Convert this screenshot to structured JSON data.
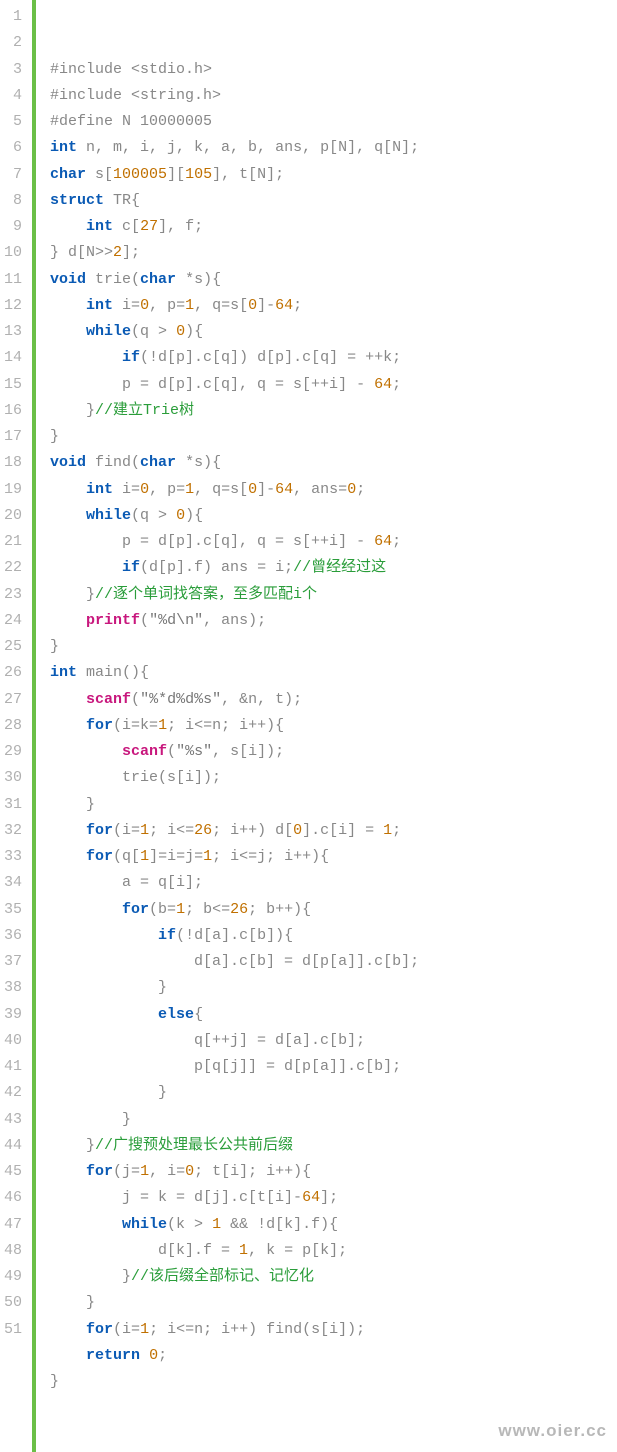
{
  "watermark": "www.oier.cc",
  "lines": [
    {
      "n": "1",
      "seg": [
        {
          "c": "pp",
          "t": "#include <stdio.h>"
        }
      ]
    },
    {
      "n": "2",
      "seg": [
        {
          "c": "pp",
          "t": "#include <string.h>"
        }
      ]
    },
    {
      "n": "3",
      "seg": [
        {
          "c": "pp",
          "t": "#define N 10000005"
        }
      ]
    },
    {
      "n": "4",
      "seg": [
        {
          "c": "type",
          "t": "int"
        },
        {
          "c": "plain",
          "t": " n, m, i, j, k, a, b, ans, p[N], q[N];"
        }
      ]
    },
    {
      "n": "5",
      "seg": [
        {
          "c": "type",
          "t": "char"
        },
        {
          "c": "plain",
          "t": " s["
        },
        {
          "c": "num",
          "t": "100005"
        },
        {
          "c": "plain",
          "t": "]["
        },
        {
          "c": "num",
          "t": "105"
        },
        {
          "c": "plain",
          "t": "], t[N];"
        }
      ]
    },
    {
      "n": "6",
      "seg": [
        {
          "c": "type",
          "t": "struct"
        },
        {
          "c": "plain",
          "t": " TR{"
        }
      ]
    },
    {
      "n": "7",
      "seg": [
        {
          "c": "plain",
          "t": "    "
        },
        {
          "c": "type",
          "t": "int"
        },
        {
          "c": "plain",
          "t": " c["
        },
        {
          "c": "num",
          "t": "27"
        },
        {
          "c": "plain",
          "t": "], f;"
        }
      ]
    },
    {
      "n": "8",
      "seg": [
        {
          "c": "plain",
          "t": "} d[N>>"
        },
        {
          "c": "num",
          "t": "2"
        },
        {
          "c": "plain",
          "t": "];"
        }
      ]
    },
    {
      "n": "9",
      "seg": [
        {
          "c": "type",
          "t": "void"
        },
        {
          "c": "plain",
          "t": " trie("
        },
        {
          "c": "type",
          "t": "char"
        },
        {
          "c": "plain",
          "t": " *s){"
        }
      ]
    },
    {
      "n": "10",
      "seg": [
        {
          "c": "plain",
          "t": "    "
        },
        {
          "c": "type",
          "t": "int"
        },
        {
          "c": "plain",
          "t": " i="
        },
        {
          "c": "num",
          "t": "0"
        },
        {
          "c": "plain",
          "t": ", p="
        },
        {
          "c": "num",
          "t": "1"
        },
        {
          "c": "plain",
          "t": ", q=s["
        },
        {
          "c": "num",
          "t": "0"
        },
        {
          "c": "plain",
          "t": "]-"
        },
        {
          "c": "num",
          "t": "64"
        },
        {
          "c": "plain",
          "t": ";"
        }
      ]
    },
    {
      "n": "11",
      "seg": [
        {
          "c": "plain",
          "t": "    "
        },
        {
          "c": "kw",
          "t": "while"
        },
        {
          "c": "plain",
          "t": "(q > "
        },
        {
          "c": "num",
          "t": "0"
        },
        {
          "c": "plain",
          "t": "){"
        }
      ]
    },
    {
      "n": "12",
      "seg": [
        {
          "c": "plain",
          "t": "        "
        },
        {
          "c": "kw",
          "t": "if"
        },
        {
          "c": "plain",
          "t": "(!d[p].c[q]) d[p].c[q] = ++k;"
        }
      ]
    },
    {
      "n": "13",
      "seg": [
        {
          "c": "plain",
          "t": "        p = d[p].c[q], q = s[++i] - "
        },
        {
          "c": "num",
          "t": "64"
        },
        {
          "c": "plain",
          "t": ";"
        }
      ]
    },
    {
      "n": "14",
      "seg": [
        {
          "c": "plain",
          "t": "    }"
        },
        {
          "c": "cmt",
          "t": "//建立Trie树"
        }
      ]
    },
    {
      "n": "15",
      "seg": [
        {
          "c": "plain",
          "t": "}"
        }
      ]
    },
    {
      "n": "16",
      "seg": [
        {
          "c": "type",
          "t": "void"
        },
        {
          "c": "plain",
          "t": " find("
        },
        {
          "c": "type",
          "t": "char"
        },
        {
          "c": "plain",
          "t": " *s){"
        }
      ]
    },
    {
      "n": "17",
      "seg": [
        {
          "c": "plain",
          "t": "    "
        },
        {
          "c": "type",
          "t": "int"
        },
        {
          "c": "plain",
          "t": " i="
        },
        {
          "c": "num",
          "t": "0"
        },
        {
          "c": "plain",
          "t": ", p="
        },
        {
          "c": "num",
          "t": "1"
        },
        {
          "c": "plain",
          "t": ", q=s["
        },
        {
          "c": "num",
          "t": "0"
        },
        {
          "c": "plain",
          "t": "]-"
        },
        {
          "c": "num",
          "t": "64"
        },
        {
          "c": "plain",
          "t": ", ans="
        },
        {
          "c": "num",
          "t": "0"
        },
        {
          "c": "plain",
          "t": ";"
        }
      ]
    },
    {
      "n": "18",
      "seg": [
        {
          "c": "plain",
          "t": "    "
        },
        {
          "c": "kw",
          "t": "while"
        },
        {
          "c": "plain",
          "t": "(q > "
        },
        {
          "c": "num",
          "t": "0"
        },
        {
          "c": "plain",
          "t": "){"
        }
      ]
    },
    {
      "n": "19",
      "seg": [
        {
          "c": "plain",
          "t": "        p = d[p].c[q], q = s[++i] - "
        },
        {
          "c": "num",
          "t": "64"
        },
        {
          "c": "plain",
          "t": ";"
        }
      ]
    },
    {
      "n": "20",
      "seg": [
        {
          "c": "plain",
          "t": "        "
        },
        {
          "c": "kw",
          "t": "if"
        },
        {
          "c": "plain",
          "t": "(d[p].f) ans = i;"
        },
        {
          "c": "cmt",
          "t": "//曾经经过这"
        }
      ]
    },
    {
      "n": "21",
      "seg": [
        {
          "c": "plain",
          "t": "    }"
        },
        {
          "c": "cmt",
          "t": "//逐个单词找答案，至多匹配i个"
        }
      ]
    },
    {
      "n": "22",
      "seg": [
        {
          "c": "plain",
          "t": "    "
        },
        {
          "c": "fn",
          "t": "printf"
        },
        {
          "c": "plain",
          "t": "("
        },
        {
          "c": "str",
          "t": "\"%d\\n\""
        },
        {
          "c": "plain",
          "t": ", ans);"
        }
      ]
    },
    {
      "n": "23",
      "seg": [
        {
          "c": "plain",
          "t": "}"
        }
      ]
    },
    {
      "n": "24",
      "seg": [
        {
          "c": "type",
          "t": "int"
        },
        {
          "c": "plain",
          "t": " main(){"
        }
      ]
    },
    {
      "n": "25",
      "seg": [
        {
          "c": "plain",
          "t": "    "
        },
        {
          "c": "fn",
          "t": "scanf"
        },
        {
          "c": "plain",
          "t": "("
        },
        {
          "c": "str",
          "t": "\"%*d%d%s\""
        },
        {
          "c": "plain",
          "t": ", &n, t);"
        }
      ]
    },
    {
      "n": "26",
      "seg": [
        {
          "c": "plain",
          "t": "    "
        },
        {
          "c": "kw",
          "t": "for"
        },
        {
          "c": "plain",
          "t": "(i=k="
        },
        {
          "c": "num",
          "t": "1"
        },
        {
          "c": "plain",
          "t": "; i<=n; i++){"
        }
      ]
    },
    {
      "n": "27",
      "seg": [
        {
          "c": "plain",
          "t": "        "
        },
        {
          "c": "fn",
          "t": "scanf"
        },
        {
          "c": "plain",
          "t": "("
        },
        {
          "c": "str",
          "t": "\"%s\""
        },
        {
          "c": "plain",
          "t": ", s[i]);"
        }
      ]
    },
    {
      "n": "28",
      "seg": [
        {
          "c": "plain",
          "t": "        trie(s[i]);"
        }
      ]
    },
    {
      "n": "29",
      "seg": [
        {
          "c": "plain",
          "t": "    }"
        }
      ]
    },
    {
      "n": "30",
      "seg": [
        {
          "c": "plain",
          "t": "    "
        },
        {
          "c": "kw",
          "t": "for"
        },
        {
          "c": "plain",
          "t": "(i="
        },
        {
          "c": "num",
          "t": "1"
        },
        {
          "c": "plain",
          "t": "; i<="
        },
        {
          "c": "num",
          "t": "26"
        },
        {
          "c": "plain",
          "t": "; i++) d["
        },
        {
          "c": "num",
          "t": "0"
        },
        {
          "c": "plain",
          "t": "].c[i] = "
        },
        {
          "c": "num",
          "t": "1"
        },
        {
          "c": "plain",
          "t": ";"
        }
      ]
    },
    {
      "n": "31",
      "seg": [
        {
          "c": "plain",
          "t": "    "
        },
        {
          "c": "kw",
          "t": "for"
        },
        {
          "c": "plain",
          "t": "(q["
        },
        {
          "c": "num",
          "t": "1"
        },
        {
          "c": "plain",
          "t": "]=i=j="
        },
        {
          "c": "num",
          "t": "1"
        },
        {
          "c": "plain",
          "t": "; i<=j; i++){"
        }
      ]
    },
    {
      "n": "32",
      "seg": [
        {
          "c": "plain",
          "t": "        a = q[i];"
        }
      ]
    },
    {
      "n": "33",
      "seg": [
        {
          "c": "plain",
          "t": "        "
        },
        {
          "c": "kw",
          "t": "for"
        },
        {
          "c": "plain",
          "t": "(b="
        },
        {
          "c": "num",
          "t": "1"
        },
        {
          "c": "plain",
          "t": "; b<="
        },
        {
          "c": "num",
          "t": "26"
        },
        {
          "c": "plain",
          "t": "; b++){"
        }
      ]
    },
    {
      "n": "34",
      "seg": [
        {
          "c": "plain",
          "t": "            "
        },
        {
          "c": "kw",
          "t": "if"
        },
        {
          "c": "plain",
          "t": "(!d[a].c[b]){"
        }
      ]
    },
    {
      "n": "35",
      "seg": [
        {
          "c": "plain",
          "t": "                d[a].c[b] = d[p[a]].c[b];"
        }
      ]
    },
    {
      "n": "36",
      "seg": [
        {
          "c": "plain",
          "t": "            }"
        }
      ]
    },
    {
      "n": "37",
      "seg": [
        {
          "c": "plain",
          "t": "            "
        },
        {
          "c": "kw",
          "t": "else"
        },
        {
          "c": "plain",
          "t": "{"
        }
      ]
    },
    {
      "n": "38",
      "seg": [
        {
          "c": "plain",
          "t": "                q[++j] = d[a].c[b];"
        }
      ]
    },
    {
      "n": "39",
      "seg": [
        {
          "c": "plain",
          "t": "                p[q[j]] = d[p[a]].c[b];"
        }
      ]
    },
    {
      "n": "40",
      "seg": [
        {
          "c": "plain",
          "t": "            }"
        }
      ]
    },
    {
      "n": "41",
      "seg": [
        {
          "c": "plain",
          "t": "        }"
        }
      ]
    },
    {
      "n": "42",
      "seg": [
        {
          "c": "plain",
          "t": "    }"
        },
        {
          "c": "cmt",
          "t": "//广搜预处理最长公共前后缀"
        }
      ]
    },
    {
      "n": "43",
      "seg": [
        {
          "c": "plain",
          "t": "    "
        },
        {
          "c": "kw",
          "t": "for"
        },
        {
          "c": "plain",
          "t": "(j="
        },
        {
          "c": "num",
          "t": "1"
        },
        {
          "c": "plain",
          "t": ", i="
        },
        {
          "c": "num",
          "t": "0"
        },
        {
          "c": "plain",
          "t": "; t[i]; i++){"
        }
      ]
    },
    {
      "n": "44",
      "seg": [
        {
          "c": "plain",
          "t": "        j = k = d[j].c[t[i]-"
        },
        {
          "c": "num",
          "t": "64"
        },
        {
          "c": "plain",
          "t": "];"
        }
      ]
    },
    {
      "n": "45",
      "seg": [
        {
          "c": "plain",
          "t": "        "
        },
        {
          "c": "kw",
          "t": "while"
        },
        {
          "c": "plain",
          "t": "(k > "
        },
        {
          "c": "num",
          "t": "1"
        },
        {
          "c": "plain",
          "t": " && !d[k].f){"
        }
      ]
    },
    {
      "n": "46",
      "seg": [
        {
          "c": "plain",
          "t": "            d[k].f = "
        },
        {
          "c": "num",
          "t": "1"
        },
        {
          "c": "plain",
          "t": ", k = p[k];"
        }
      ]
    },
    {
      "n": "47",
      "seg": [
        {
          "c": "plain",
          "t": "        }"
        },
        {
          "c": "cmt",
          "t": "//该后缀全部标记、记忆化"
        }
      ]
    },
    {
      "n": "48",
      "seg": [
        {
          "c": "plain",
          "t": "    }"
        }
      ]
    },
    {
      "n": "49",
      "seg": [
        {
          "c": "plain",
          "t": "    "
        },
        {
          "c": "kw",
          "t": "for"
        },
        {
          "c": "plain",
          "t": "(i="
        },
        {
          "c": "num",
          "t": "1"
        },
        {
          "c": "plain",
          "t": "; i<=n; i++) find(s[i]);"
        }
      ]
    },
    {
      "n": "50",
      "seg": [
        {
          "c": "plain",
          "t": "    "
        },
        {
          "c": "kw",
          "t": "return"
        },
        {
          "c": "plain",
          "t": " "
        },
        {
          "c": "num",
          "t": "0"
        },
        {
          "c": "plain",
          "t": ";"
        }
      ]
    },
    {
      "n": "51",
      "seg": [
        {
          "c": "plain",
          "t": "}"
        }
      ]
    }
  ]
}
